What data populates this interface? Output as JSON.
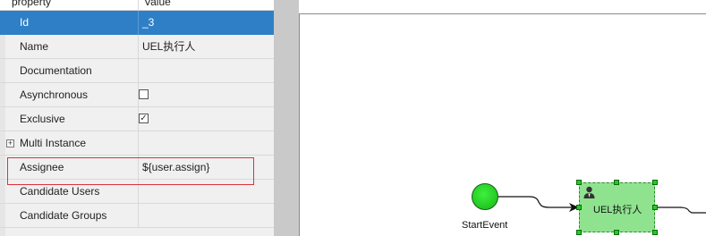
{
  "properties_panel": {
    "header": {
      "property_col": "property",
      "value_col": "Value"
    },
    "rows": [
      {
        "label": "Id",
        "value": "_3",
        "selected": true
      },
      {
        "label": "Name",
        "value": "UEL执行人"
      },
      {
        "label": "Documentation",
        "value": ""
      },
      {
        "label": "Asynchronous",
        "checked": false
      },
      {
        "label": "Exclusive",
        "checked": true
      },
      {
        "label": "Multi Instance",
        "value": ""
      },
      {
        "label": "Assignee",
        "value": "${user.assign}",
        "highlighted": true
      },
      {
        "label": "Candidate Users",
        "value": ""
      },
      {
        "label": "Candidate Groups",
        "value": ""
      }
    ]
  },
  "diagram": {
    "start_event": {
      "label": "StartEvent",
      "color": "#22c022"
    },
    "user_task": {
      "label": "UEL执行人",
      "icon": "user-icon",
      "color": "#8fe38f"
    }
  },
  "colors": {
    "selection": "#2f7fc6",
    "highlight_box": "#e0303a"
  }
}
